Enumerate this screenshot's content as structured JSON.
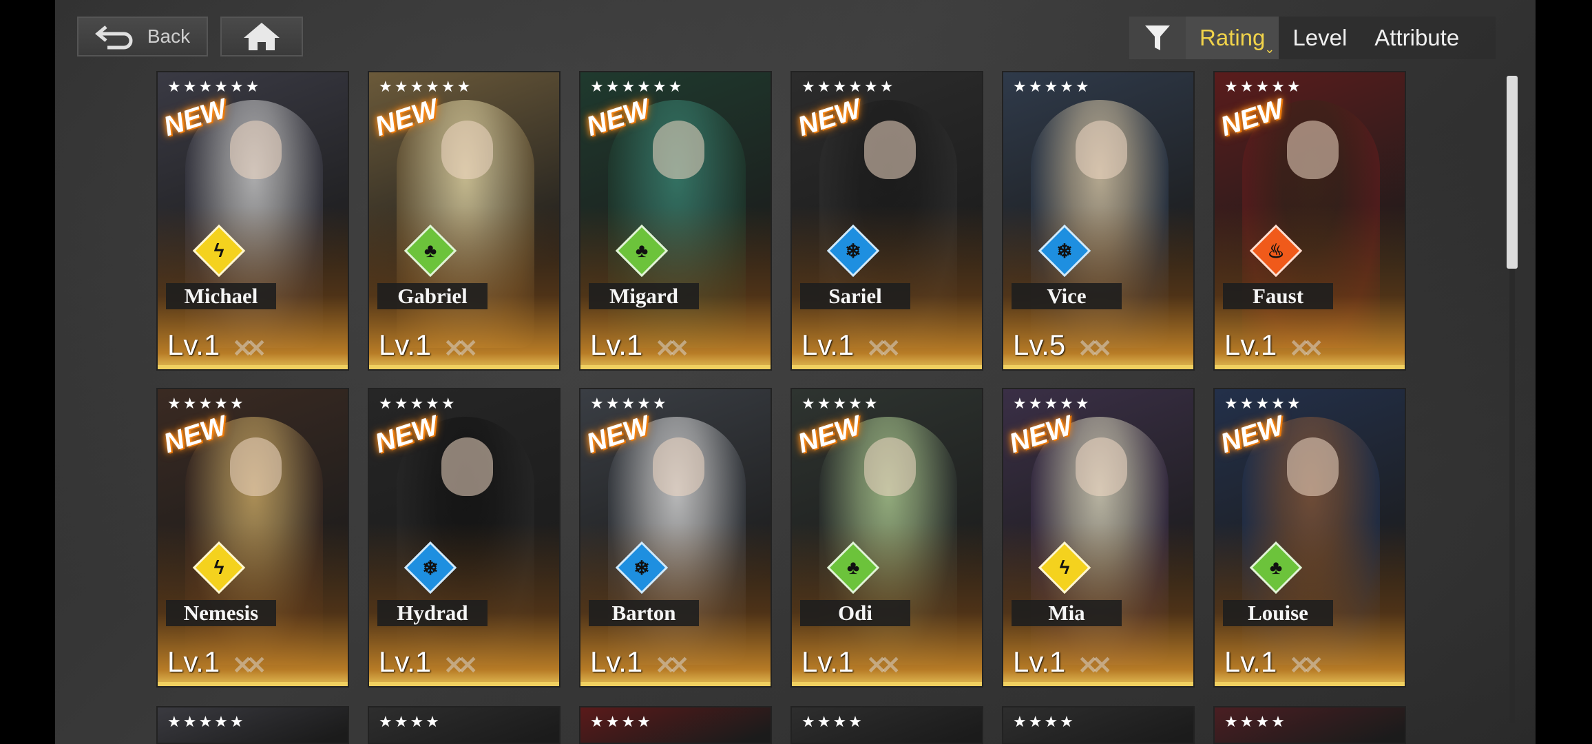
{
  "nav": {
    "back_label": "Back"
  },
  "sort": {
    "options": [
      "Rating",
      "Level",
      "Attribute"
    ],
    "active": "Rating"
  },
  "colors": {
    "accent": "#f1d34a",
    "lightning": "#f4d21e",
    "forest": "#6cc33b",
    "ice": "#1e8fe0",
    "fire": "#f05a1a"
  },
  "cards": [
    {
      "name": "Michael",
      "level": "Lv.1",
      "stars": "★★★★★★",
      "new_label": "NEW",
      "attribute": "lightning-icon",
      "attr_color": "#f4d21e",
      "tint": "#3a3a44",
      "hair": "#d8d8d8"
    },
    {
      "name": "Gabriel",
      "level": "Lv.1",
      "stars": "★★★★★★",
      "new_label": "NEW",
      "attribute": "forest-icon",
      "attr_color": "#6cc33b",
      "tint": "#6b5a3a",
      "hair": "#f1e4b0"
    },
    {
      "name": "Migard",
      "level": "Lv.1",
      "stars": "★★★★★★",
      "new_label": "NEW",
      "attribute": "forest-icon",
      "attr_color": "#6cc33b",
      "tint": "#1f3a2e",
      "hair": "#3b8a78"
    },
    {
      "name": "Sariel",
      "level": "Lv.1",
      "stars": "★★★★★★",
      "new_label": "NEW",
      "attribute": "ice-icon",
      "attr_color": "#1e8fe0",
      "tint": "#2c2c2c",
      "hair": "#1a1a1a"
    },
    {
      "name": "Vice",
      "level": "Lv.5",
      "stars": "★★★★★",
      "new_label": "",
      "attribute": "ice-icon",
      "attr_color": "#1e8fe0",
      "tint": "#2f3a4a",
      "hair": "#e5d3b0"
    },
    {
      "name": "Faust",
      "level": "Lv.1",
      "stars": "★★★★★",
      "new_label": "NEW",
      "attribute": "fire-icon",
      "attr_color": "#f05a1a",
      "tint": "#5a1c1c",
      "hair": "#3a2418"
    },
    {
      "name": "Nemesis",
      "level": "Lv.1",
      "stars": "★★★★★",
      "new_label": "NEW",
      "attribute": "lightning-icon",
      "attr_color": "#f4d21e",
      "tint": "#3a2a22",
      "hair": "#d8b46a"
    },
    {
      "name": "Hydrad",
      "level": "Lv.1",
      "stars": "★★★★★",
      "new_label": "NEW",
      "attribute": "ice-icon",
      "attr_color": "#1e8fe0",
      "tint": "#262626",
      "hair": "#111111"
    },
    {
      "name": "Barton",
      "level": "Lv.1",
      "stars": "★★★★★",
      "new_label": "NEW",
      "attribute": "ice-icon",
      "attr_color": "#1e8fe0",
      "tint": "#3a3e44",
      "hair": "#e8e8e8"
    },
    {
      "name": "Odi",
      "level": "Lv.1",
      "stars": "★★★★★",
      "new_label": "NEW",
      "attribute": "forest-icon",
      "attr_color": "#6cc33b",
      "tint": "#2e3430",
      "hair": "#b8d89a"
    },
    {
      "name": "Mia",
      "level": "Lv.1",
      "stars": "★★★★★",
      "new_label": "NEW",
      "attribute": "lightning-icon",
      "attr_color": "#f4d21e",
      "tint": "#3a2f46",
      "hair": "#e8e4c8"
    },
    {
      "name": "Louise",
      "level": "Lv.1",
      "stars": "★★★★★",
      "new_label": "NEW",
      "attribute": "forest-icon",
      "attr_color": "#6cc33b",
      "tint": "#23304a",
      "hair": "#8a5a3a"
    }
  ],
  "partial_row": [
    {
      "stars": "★★★★★",
      "tint": "#3a3a40"
    },
    {
      "stars": "★★★★",
      "tint": "#2e2e2e"
    },
    {
      "stars": "★★★★",
      "tint": "#5a1a1a"
    },
    {
      "stars": "★★★★",
      "tint": "#2e2e2e"
    },
    {
      "stars": "★★★★",
      "tint": "#2e2e2e"
    },
    {
      "stars": "★★★★",
      "tint": "#4a1e22"
    }
  ]
}
